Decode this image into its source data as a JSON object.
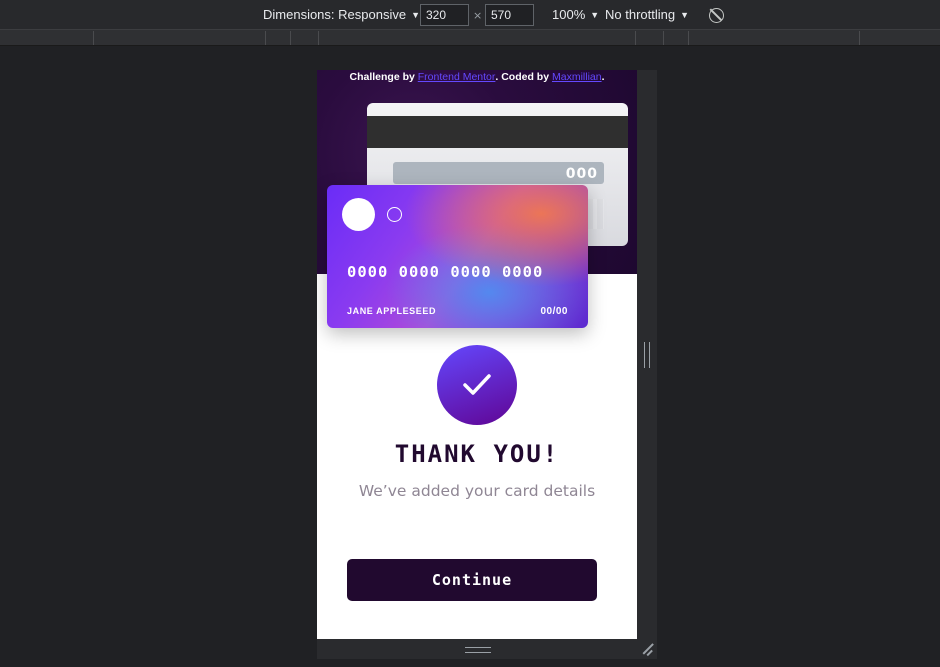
{
  "toolbar": {
    "dimensions_label": "Dimensions: Responsive",
    "width_value": "320",
    "times": "×",
    "height_value": "570",
    "zoom_label": "100%",
    "throttling_label": "No throttling",
    "rotate_icon": "rotate-icon"
  },
  "page": {
    "credit_prefix": "Challenge by ",
    "credit_link1": "Frontend Mentor",
    "credit_middle": ". Coded by ",
    "credit_link2": "Maxmillian",
    "credit_suffix": ".",
    "card_back": {
      "cvc": "000"
    },
    "card_front": {
      "number": "0000 0000 0000 0000",
      "name": "JANE APPLESEED",
      "expiry": "00/00"
    },
    "success_icon": "check-icon",
    "title": "THANK YOU!",
    "subtitle": "We’ve added your card details",
    "continue_label": "Continue"
  },
  "colors": {
    "accent": "#6448fe",
    "dark": "#21092f",
    "muted": "#8f8694",
    "devtools_bg": "#202124"
  }
}
